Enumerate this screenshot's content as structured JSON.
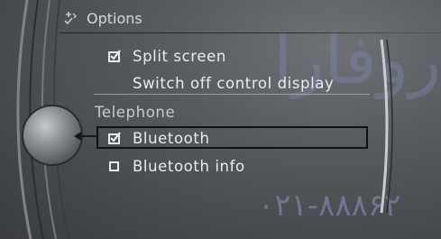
{
  "header": {
    "title": "Options",
    "icon": "options-icon"
  },
  "menu": {
    "items": [
      {
        "label": "Split screen",
        "state": "checked"
      },
      {
        "label": "Switch off control display",
        "state": "none"
      }
    ],
    "section": "Telephone",
    "section_items": [
      {
        "label": "Bluetooth",
        "state": "checked",
        "selected": true
      },
      {
        "label": "Bluetooth info",
        "state": "unchecked"
      }
    ]
  },
  "watermark": {
    "logo_text": "روفارا",
    "phone": "۰۲۱-۸۸۸۶۲"
  },
  "colors": {
    "text": "#eaecee",
    "background": "#585b5f",
    "highlight_border": "#101112",
    "watermark": "#7e88b2"
  }
}
